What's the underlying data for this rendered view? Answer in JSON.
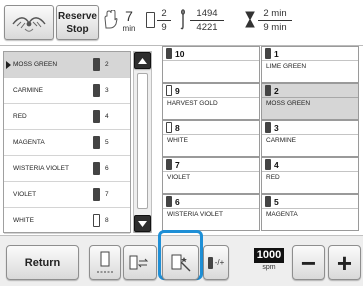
{
  "top": {
    "reserve_stop_label_1": "Reserve",
    "reserve_stop_label_2": "Stop",
    "time_value": "7",
    "time_unit": "min",
    "color_frac_top": "2",
    "color_frac_bottom": "9",
    "stitch_frac_top": "1494",
    "stitch_frac_bottom": "4221",
    "min_frac_top": "2 min",
    "min_frac_bottom": "9 min"
  },
  "thread_list": [
    {
      "name": "MOSS GREEN",
      "num": "2",
      "spool": "dark",
      "selected": true
    },
    {
      "name": "CARMINE",
      "num": "3",
      "spool": "dark",
      "selected": false
    },
    {
      "name": "RED",
      "num": "4",
      "spool": "dark",
      "selected": false
    },
    {
      "name": "MAGENTA",
      "num": "5",
      "spool": "dark",
      "selected": false
    },
    {
      "name": "WISTERIA VIOLET",
      "num": "6",
      "spool": "dark",
      "selected": false
    },
    {
      "name": "VIOLET",
      "num": "7",
      "spool": "dark",
      "selected": false
    },
    {
      "name": "WHITE",
      "num": "8",
      "spool": "light",
      "selected": false
    }
  ],
  "needle_bars": [
    {
      "num": "10",
      "name": "",
      "spool": "dark",
      "selected": false
    },
    {
      "num": "1",
      "name": "LIME GREEN",
      "spool": "dark",
      "selected": false
    },
    {
      "num": "9",
      "name": "HARVEST GOLD",
      "spool": "light",
      "selected": false
    },
    {
      "num": "2",
      "name": "MOSS GREEN",
      "spool": "dark",
      "selected": true
    },
    {
      "num": "8",
      "name": "WHITE",
      "spool": "light",
      "selected": false
    },
    {
      "num": "3",
      "name": "CARMINE",
      "spool": "dark",
      "selected": false
    },
    {
      "num": "7",
      "name": "VIOLET",
      "spool": "dark",
      "selected": false
    },
    {
      "num": "4",
      "name": "RED",
      "spool": "dark",
      "selected": false
    },
    {
      "num": "6",
      "name": "WISTERIA VIOLET",
      "spool": "dark",
      "selected": false
    },
    {
      "num": "5",
      "name": "MAGENTA",
      "spool": "dark",
      "selected": false
    }
  ],
  "bottom": {
    "return_label": "Return",
    "speed_value": "1000",
    "speed_unit": "spm",
    "minus_label": "−",
    "plus_label": "+",
    "minus_plus_small": "-/+"
  },
  "colors": {
    "highlight_blue": "#1e8fd6",
    "selected_row": "#d6d6d6",
    "bar_bg": "#eeeeee"
  }
}
